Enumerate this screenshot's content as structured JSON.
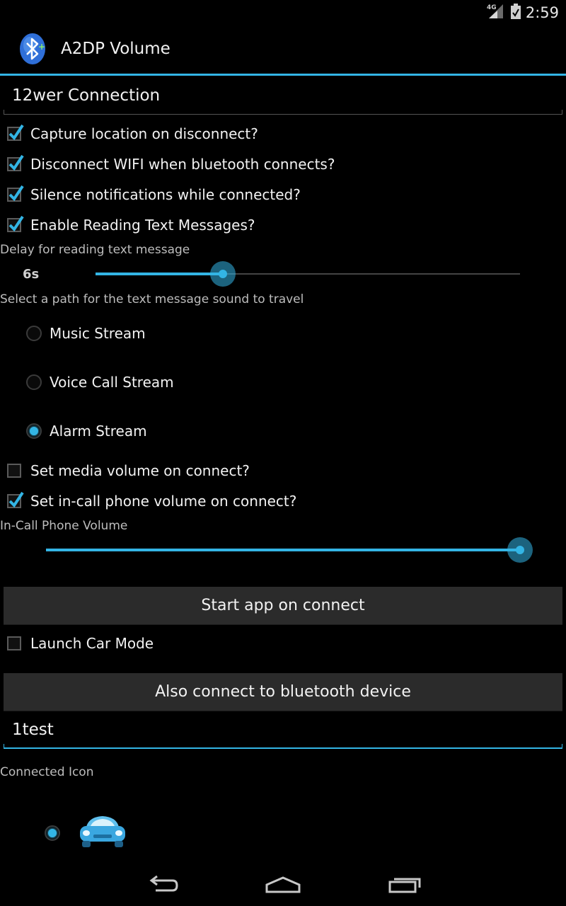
{
  "status_bar": {
    "network": "4G",
    "time": "2:59"
  },
  "app": {
    "title": "A2DP Volume",
    "icon": "bluetooth-app-icon"
  },
  "device_name": "12wer Connection",
  "options": [
    {
      "label": "Capture location on disconnect?",
      "checked": true
    },
    {
      "label": "Disconnect WIFI when bluetooth connects?",
      "checked": true
    },
    {
      "label": "Silence notifications while connected?",
      "checked": true
    },
    {
      "label": "Enable Reading Text Messages?",
      "checked": true
    }
  ],
  "delay": {
    "label": "Delay for reading text message",
    "value_label": "6s",
    "fraction": 0.3
  },
  "stream": {
    "label": "Select a path for the text message sound to travel",
    "options": [
      {
        "label": "Music Stream",
        "selected": false
      },
      {
        "label": "Voice Call Stream",
        "selected": false
      },
      {
        "label": "Alarm Stream",
        "selected": true
      }
    ]
  },
  "volume_options": [
    {
      "label": "Set media volume on connect?",
      "checked": false
    },
    {
      "label": "Set in-call phone volume on connect?",
      "checked": true
    }
  ],
  "in_call_volume": {
    "label": "In-Call Phone Volume",
    "fraction": 1.0
  },
  "start_app_button": "Start app on connect",
  "car_mode": {
    "label": "Launch Car Mode",
    "checked": false
  },
  "also_connect_button": "Also connect to bluetooth device",
  "also_connect_device": "1test",
  "connected_icon": {
    "label": "Connected Icon",
    "selected": true,
    "icon": "car-icon"
  },
  "colors": {
    "accent": "#33b5e5",
    "background": "#000000",
    "button": "#2b2b2b"
  },
  "nav": {
    "back": "back-icon",
    "home": "home-icon",
    "recents": "recents-icon"
  }
}
